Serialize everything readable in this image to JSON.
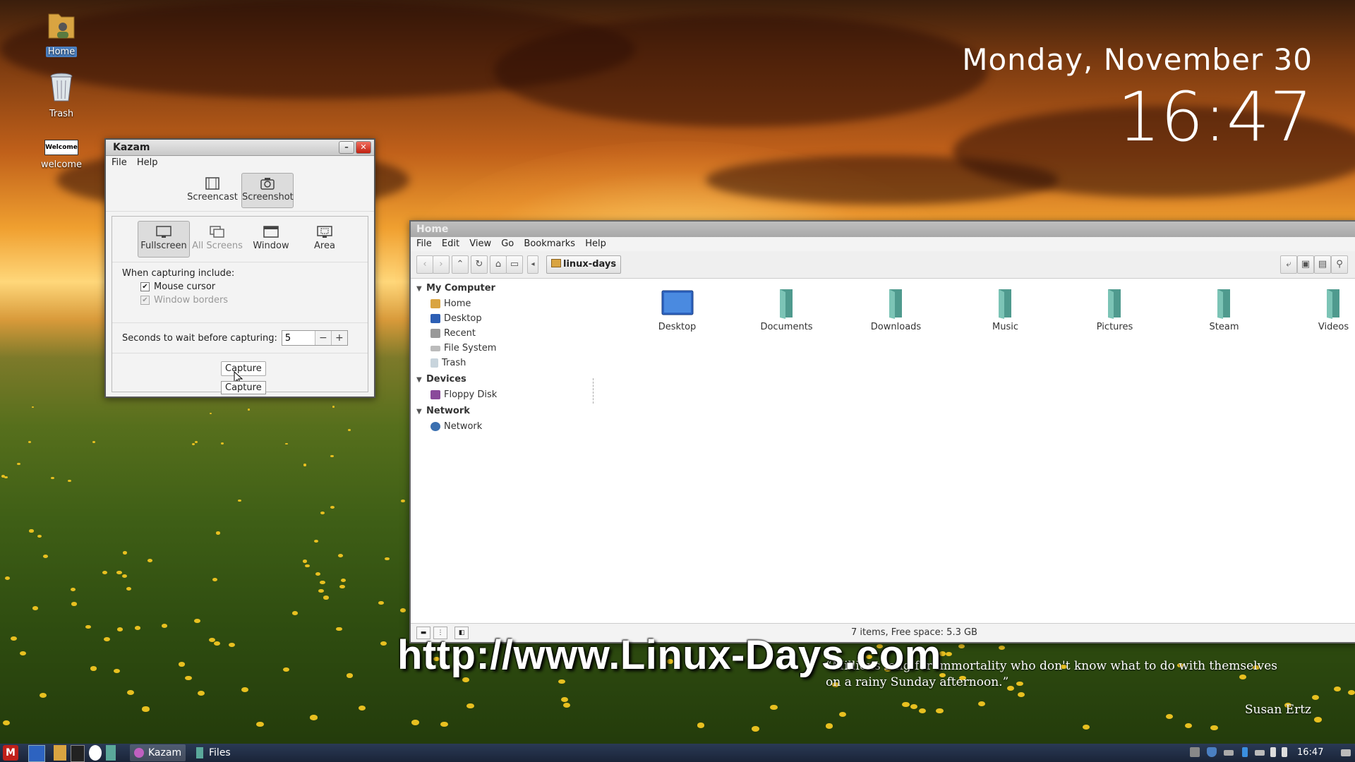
{
  "desktop": {
    "icons": [
      {
        "label": "Home"
      },
      {
        "label": "Trash"
      },
      {
        "label": "welcome",
        "badge_text": "Welcome"
      }
    ],
    "clock": {
      "date": "Monday, November 30",
      "time": "16:47"
    },
    "watermark": "http://www.Linux-Days.com",
    "quote": {
      "text": "“Millions long for immortality who don't know what to do with themselves on a rainy Sunday afternoon.”",
      "author": "Susan Ertz"
    }
  },
  "kazam": {
    "title": "Kazam",
    "menu": [
      "File",
      "Help"
    ],
    "modes": [
      {
        "label": "Screencast"
      },
      {
        "label": "Screenshot"
      }
    ],
    "types": [
      {
        "label": "Fullscreen"
      },
      {
        "label": "All Screens"
      },
      {
        "label": "Window"
      },
      {
        "label": "Area"
      }
    ],
    "include_label": "When capturing include:",
    "options": [
      {
        "label": "Mouse cursor",
        "checked": true
      },
      {
        "label": "Window borders",
        "checked": true
      }
    ],
    "delay_label": "Seconds to wait before capturing:",
    "delay_value": "5",
    "minus": "−",
    "plus": "+",
    "capture_label": "Capture",
    "tooltip": "Capture"
  },
  "files": {
    "title": "Home",
    "menu": [
      "File",
      "Edit",
      "View",
      "Go",
      "Bookmarks",
      "Help"
    ],
    "breadcrumb": "linux-days",
    "sidebar": {
      "sections": [
        {
          "title": "My Computer",
          "items": [
            "Home",
            "Desktop",
            "Recent",
            "File System",
            "Trash"
          ]
        },
        {
          "title": "Devices",
          "items": [
            "Floppy Disk"
          ]
        },
        {
          "title": "Network",
          "items": [
            "Network"
          ]
        }
      ]
    },
    "folders": [
      "Desktop",
      "Documents",
      "Downloads",
      "Music",
      "Pictures",
      "Steam",
      "Videos"
    ],
    "status": "7 items, Free space: 5.3 GB"
  },
  "panel": {
    "tasks": [
      {
        "label": "Kazam"
      },
      {
        "label": "Files"
      }
    ],
    "time": "16:47"
  },
  "colors": {
    "accent": "#4a7fc1",
    "panel": "#1a2438",
    "folder": "#5aa89a"
  }
}
